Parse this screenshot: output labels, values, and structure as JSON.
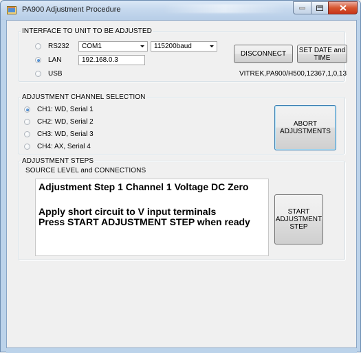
{
  "window": {
    "title": "PA900 Adjustment Procedure"
  },
  "interface_group": {
    "legend": "INTERFACE TO UNIT TO BE ADJUSTED",
    "options": [
      {
        "label": "RS232",
        "checked": false
      },
      {
        "label": "LAN",
        "checked": true
      },
      {
        "label": "USB",
        "checked": false
      }
    ],
    "com_port": "COM1",
    "baud_rate": "115200baud",
    "ip_address": "192.168.0.3",
    "disconnect_label": "DISCONNECT",
    "set_date_label": "SET DATE and\nTIME",
    "device_id": "VITREK,PA900/H500,12367,1,0,13"
  },
  "channel_group": {
    "legend": "ADJUSTMENT CHANNEL SELECTION",
    "channels": [
      {
        "label": "CH1: WD, Serial 1",
        "checked": true
      },
      {
        "label": "CH2: WD, Serial 2",
        "checked": false
      },
      {
        "label": "CH3: WD, Serial 3",
        "checked": false
      },
      {
        "label": "CH4: AX, Serial 4",
        "checked": false
      }
    ],
    "abort_label": "ABORT\nADJUSTMENTS"
  },
  "steps_group": {
    "legend": "ADJUSTMENT STEPS",
    "source_legend": "SOURCE LEVEL and CONNECTIONS",
    "step_title": "Adjustment Step 1 Channel 1 Voltage DC Zero",
    "instruction_1": "Apply short circuit to V input terminals",
    "instruction_2": "Press START ADJUSTMENT STEP when ready",
    "start_label": "START\nADJUSTMENT\nSTEP"
  }
}
